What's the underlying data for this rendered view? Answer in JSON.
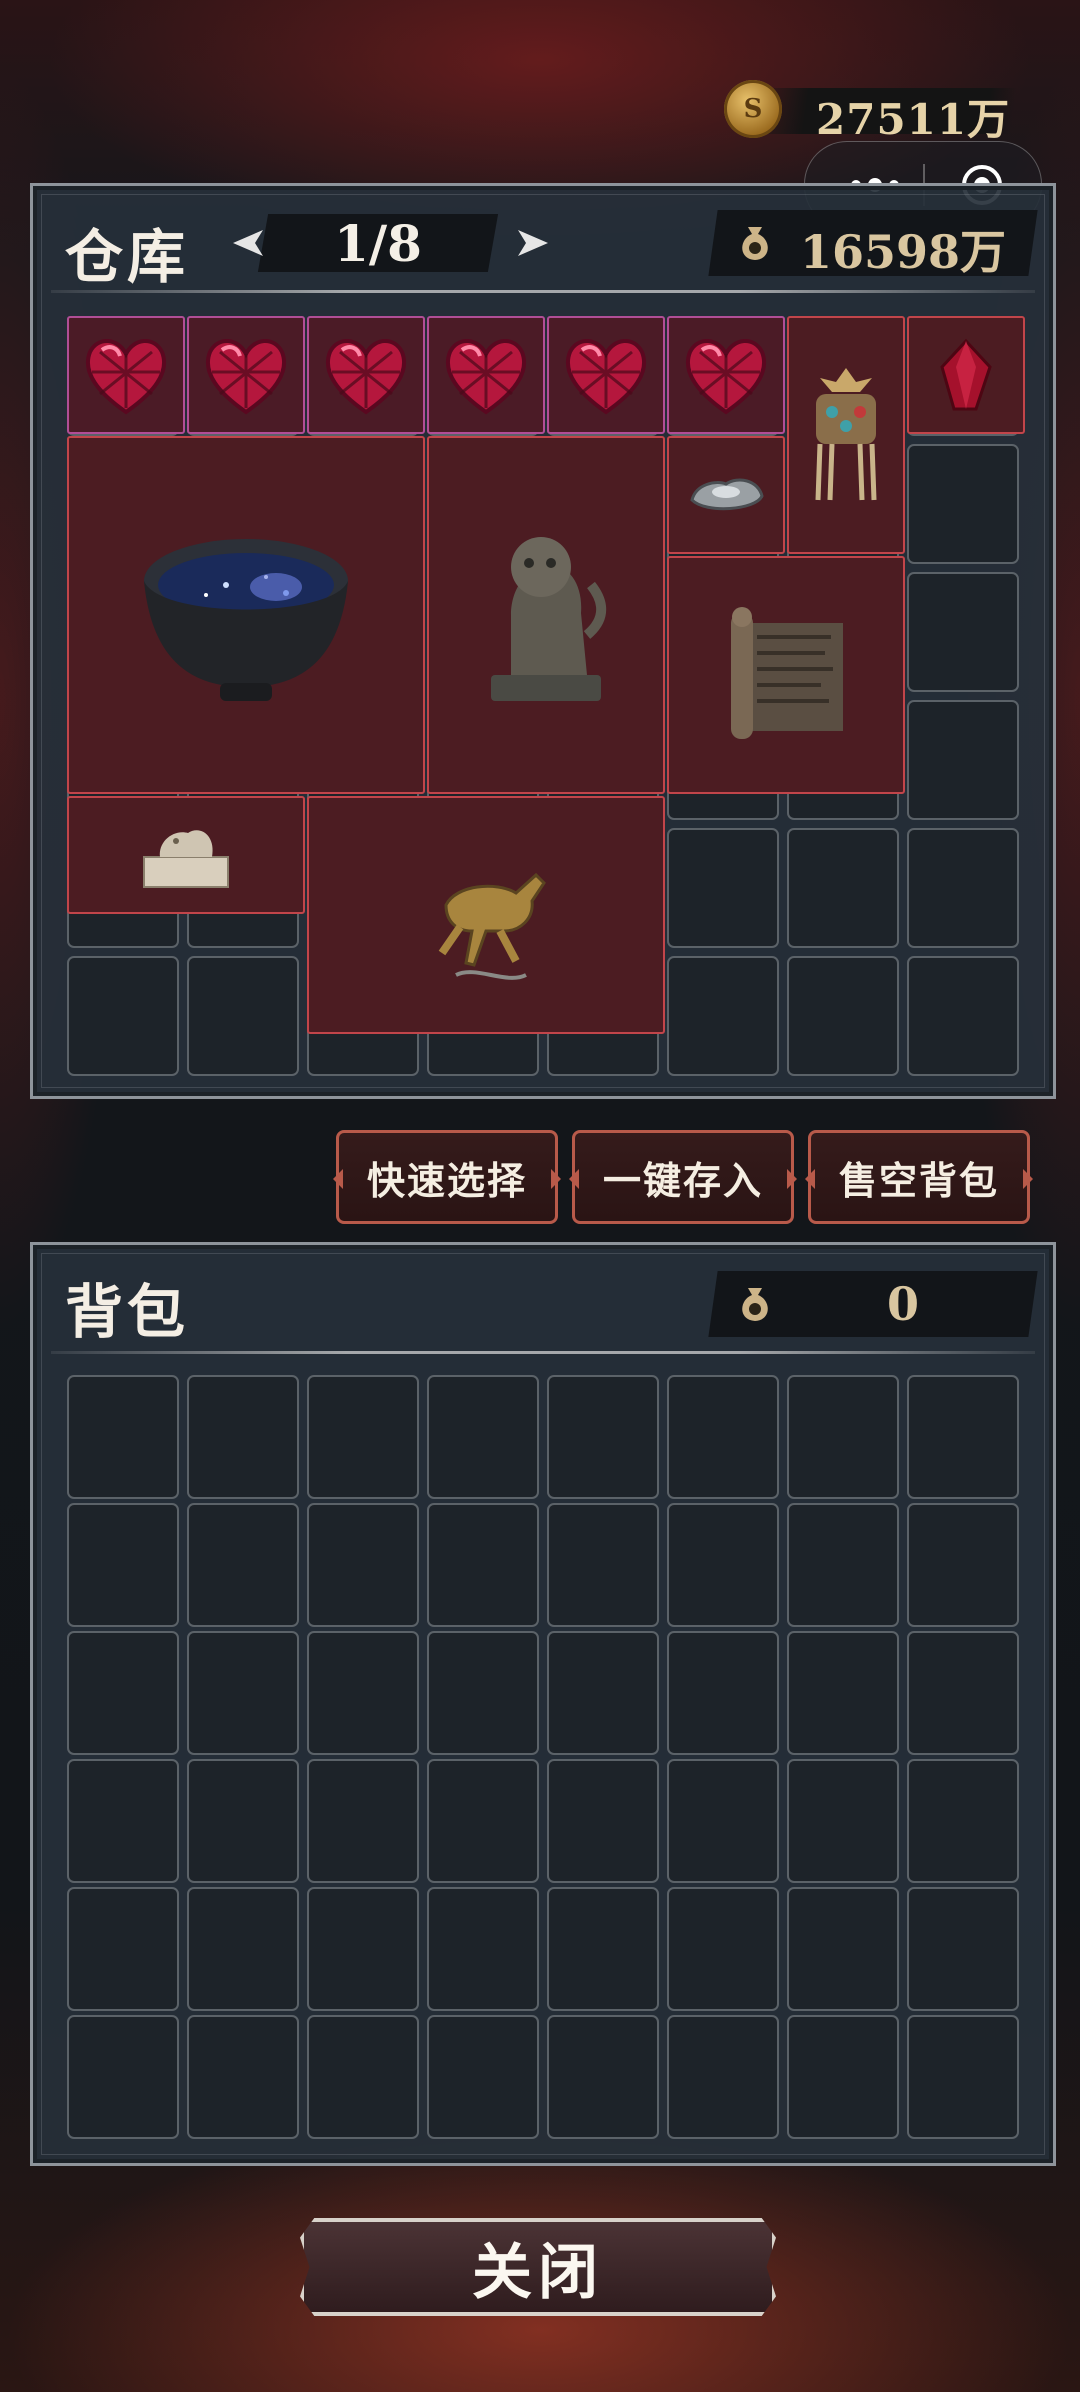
{
  "header": {
    "coins": "27511万"
  },
  "capsule": {
    "more": "more-icon",
    "close": "target-icon"
  },
  "warehouse": {
    "title": "仓库",
    "page": "1/8",
    "value": "16598万",
    "items": [
      {
        "name": "heart-gem",
        "icon": "heart-gem-icon",
        "rarity": "purple"
      },
      {
        "name": "heart-gem",
        "icon": "heart-gem-icon",
        "rarity": "purple"
      },
      {
        "name": "heart-gem",
        "icon": "heart-gem-icon",
        "rarity": "purple"
      },
      {
        "name": "heart-gem",
        "icon": "heart-gem-icon",
        "rarity": "purple"
      },
      {
        "name": "heart-gem",
        "icon": "heart-gem-icon",
        "rarity": "purple"
      },
      {
        "name": "heart-gem",
        "icon": "heart-gem-icon",
        "rarity": "purple"
      },
      {
        "name": "phoenix-crown",
        "icon": "phoenix-crown-icon",
        "rarity": "red"
      },
      {
        "name": "red-crystal",
        "icon": "red-crystal-icon",
        "rarity": "red"
      },
      {
        "name": "starry-tea-bowl",
        "icon": "tea-bowl-icon",
        "rarity": "red"
      },
      {
        "name": "bronze-lion",
        "icon": "bronze-lion-icon",
        "rarity": "red"
      },
      {
        "name": "silver-ingot",
        "icon": "silver-ingot-icon",
        "rarity": "red"
      },
      {
        "name": "ancient-scroll",
        "icon": "scroll-icon",
        "rarity": "red"
      },
      {
        "name": "jade-seal",
        "icon": "jade-seal-icon",
        "rarity": "red"
      },
      {
        "name": "galloping-horse",
        "icon": "bronze-horse-icon",
        "rarity": "red"
      }
    ]
  },
  "actions": {
    "quick_select": "快速选择",
    "deposit_all": "一键存入",
    "sell_all": "售空背包"
  },
  "backpack": {
    "title": "背包",
    "value": "0"
  },
  "footer": {
    "close": "关闭"
  },
  "colors": {
    "item_red_border": "#c2454a",
    "item_purple_border": "#b14e96",
    "gold_text": "#d9c6a0"
  }
}
